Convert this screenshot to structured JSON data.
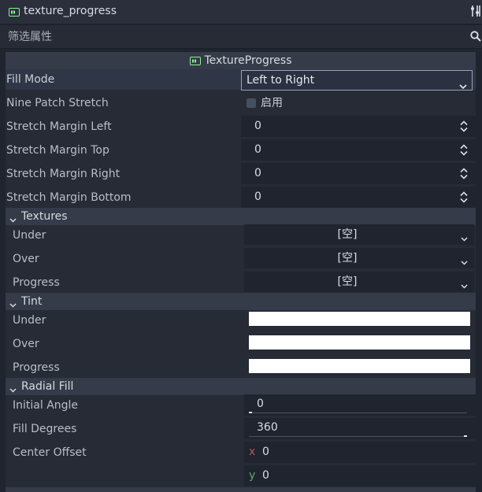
{
  "header": {
    "title": "texture_progress",
    "node_icon": "texture-progress-node-icon",
    "tools_icon": "object-tools-icon"
  },
  "filter": {
    "placeholder": "筛选属性",
    "icon": "search-icon"
  },
  "class_header": {
    "label": "TextureProgress",
    "icon": "texture-progress-class-icon"
  },
  "properties": {
    "fill_mode": {
      "label": "Fill Mode",
      "value": "Left to Right"
    },
    "nine_patch": {
      "label": "Nine Patch Stretch",
      "checkbox_label": "启用",
      "checked": false
    },
    "margin_left": {
      "label": "Stretch Margin Left",
      "value": "0"
    },
    "margin_top": {
      "label": "Stretch Margin Top",
      "value": "0"
    },
    "margin_right": {
      "label": "Stretch Margin Right",
      "value": "0"
    },
    "margin_bottom": {
      "label": "Stretch Margin Bottom",
      "value": "0"
    }
  },
  "textures": {
    "label": "Textures",
    "under": {
      "label": "Under",
      "value": "[空]"
    },
    "over": {
      "label": "Over",
      "value": "[空]"
    },
    "progress": {
      "label": "Progress",
      "value": "[空]"
    }
  },
  "tint": {
    "label": "Tint",
    "under": {
      "label": "Under",
      "color": "#ffffff"
    },
    "over": {
      "label": "Over",
      "color": "#ffffff"
    },
    "progress": {
      "label": "Progress",
      "color": "#ffffff"
    }
  },
  "radial_fill": {
    "label": "Radial Fill",
    "initial_angle": {
      "label": "Initial Angle",
      "value": "0",
      "fraction": 0.0
    },
    "fill_degrees": {
      "label": "Fill Degrees",
      "value": "360",
      "fraction": 1.0
    },
    "center_offset": {
      "label": "Center Offset",
      "x_label": "x",
      "x": "0",
      "y_label": "y",
      "y": "0"
    }
  },
  "colors": {
    "accent": "#8eef97",
    "axis_x": "#b5575a",
    "axis_y": "#5bab66"
  }
}
